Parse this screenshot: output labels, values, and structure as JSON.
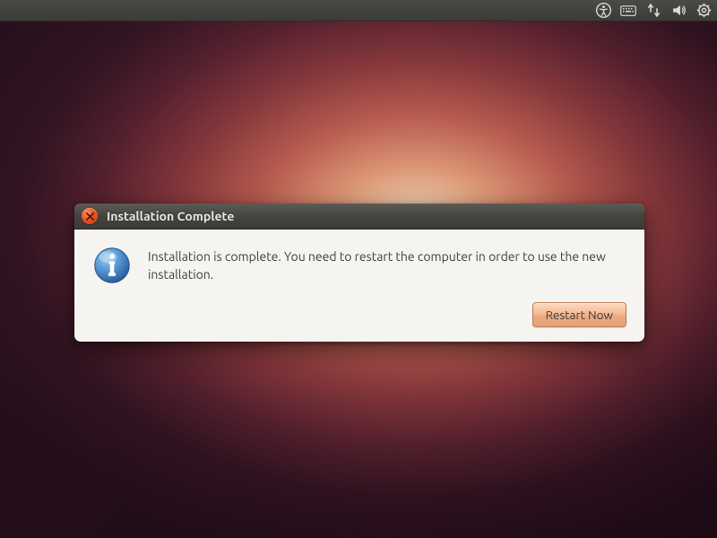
{
  "dialog": {
    "title": "Installation Complete",
    "message": "Installation is complete. You need to restart the computer in order to use the new installation.",
    "restart_label": "Restart Now"
  }
}
